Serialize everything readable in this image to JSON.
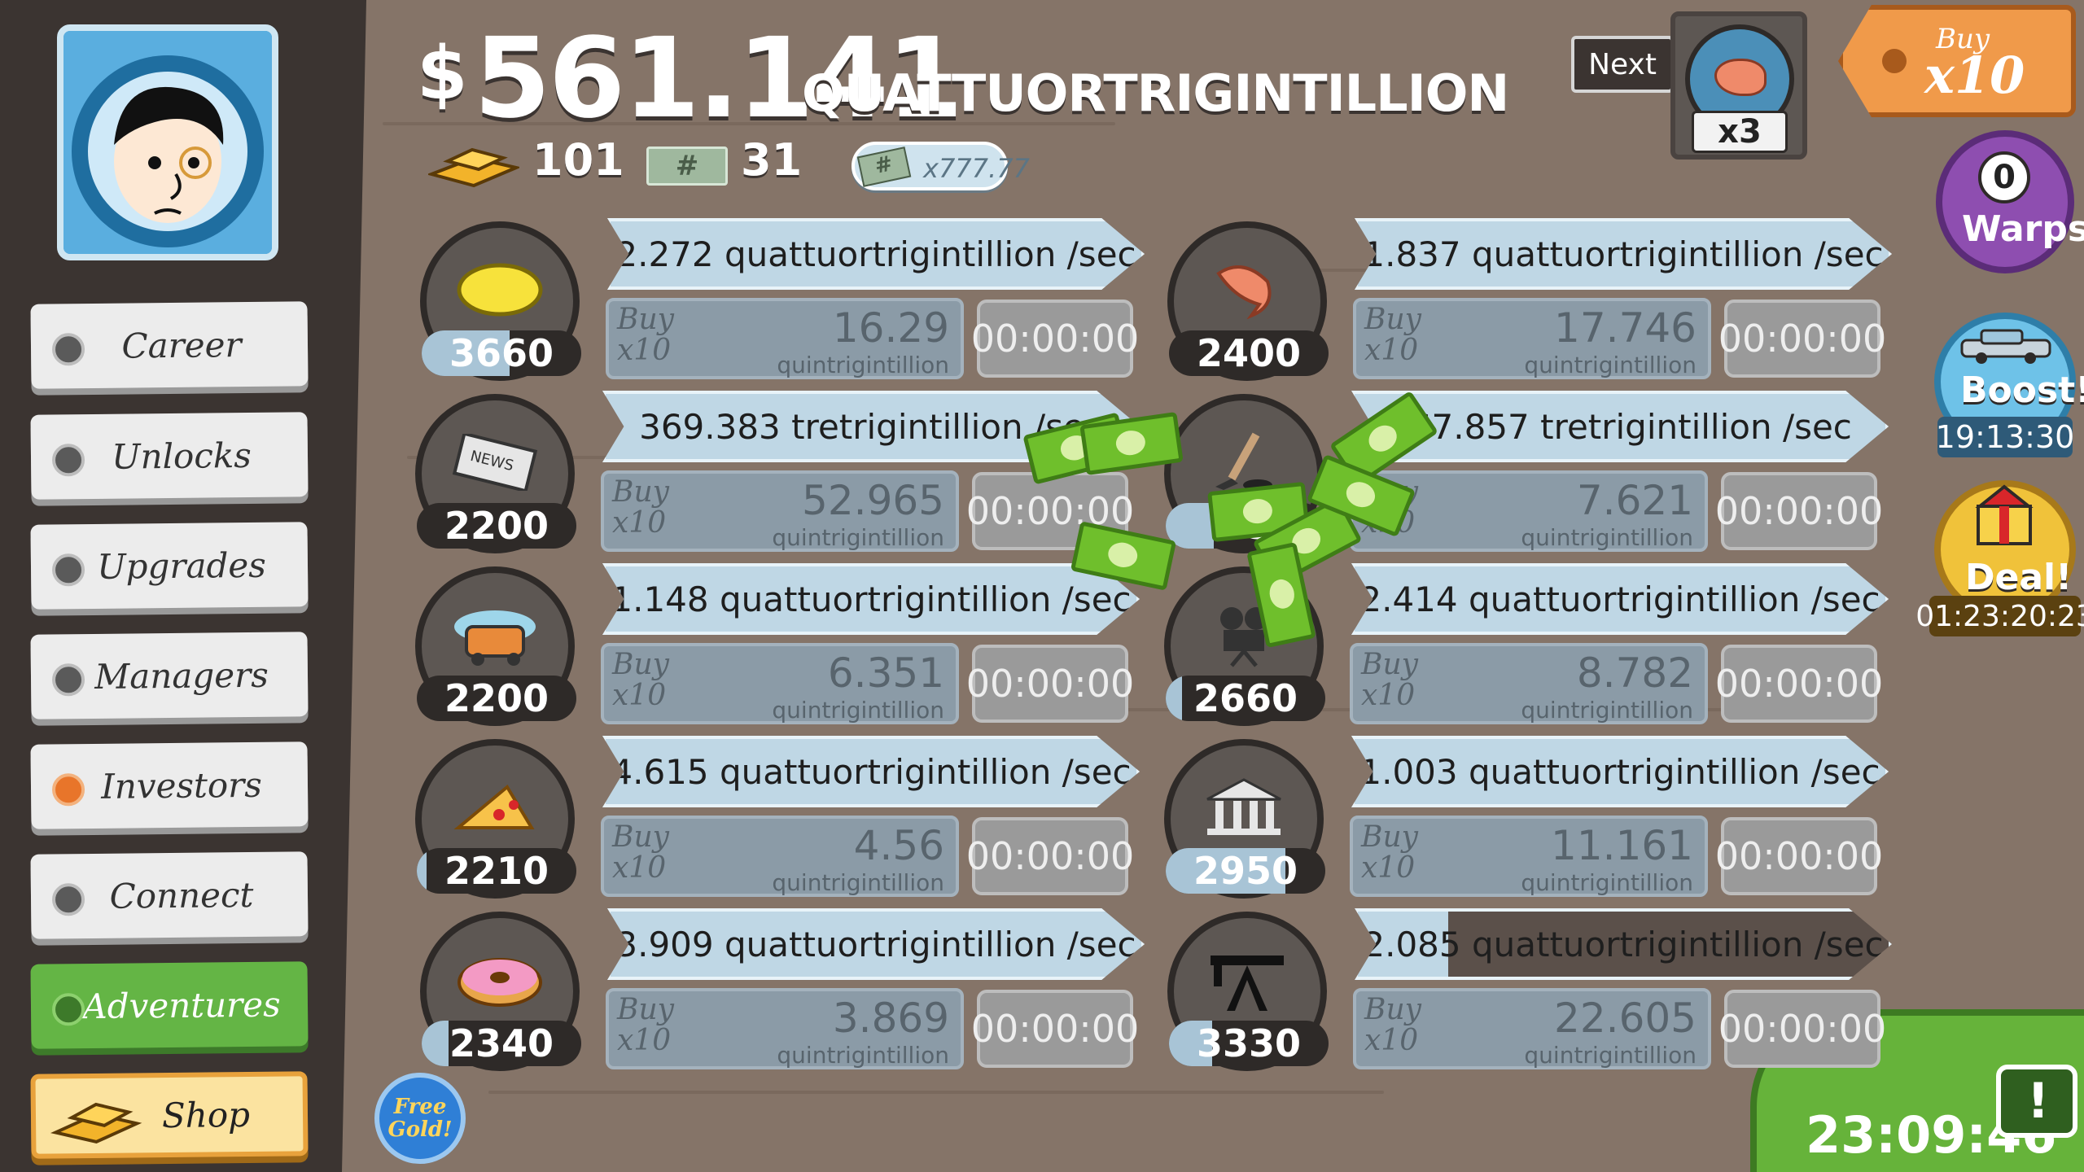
{
  "money": {
    "symbol": "$",
    "amount": "561.141",
    "unit": "QUATTUORTRIGINTILLION"
  },
  "currencies": {
    "gold": "101",
    "megabucks": "31",
    "multiplier_ticket": "x777.77"
  },
  "sidebar": {
    "items": [
      {
        "label": "Career"
      },
      {
        "label": "Unlocks"
      },
      {
        "label": "Upgrades"
      },
      {
        "label": "Managers"
      },
      {
        "label": "Investors"
      },
      {
        "label": "Connect"
      },
      {
        "label": "Adventures"
      },
      {
        "label": "Shop"
      }
    ],
    "free_gold": "Free Gold!"
  },
  "top_right": {
    "next_label": "Next",
    "next_multiplier": "x3",
    "buy_label": "Buy",
    "buy_amount": "x10",
    "warps_count": "0",
    "warps_label": "Warps",
    "boost_label": "Boost!",
    "boost_timer": "19:13:30",
    "deal_label": "Deal!",
    "deal_timer": "01:23:20:23",
    "clock": "23:09:46"
  },
  "ventures": [
    {
      "icon": "lemon-icon",
      "count": "3660",
      "count_fill": 0.55,
      "rate": "2.272 quattuortrigintillion /sec",
      "buy": "Buy",
      "mult": "x10",
      "cost": "16.29",
      "cost_unit": "quintrigintillion",
      "timer": "00:00:00"
    },
    {
      "icon": "newspaper-icon",
      "count": "2200",
      "count_fill": 0.0,
      "rate": "369.383 tretrigintillion /sec",
      "buy": "Buy",
      "mult": "x10",
      "cost": "52.965",
      "cost_unit": "quintrigintillion",
      "timer": "00:00:00"
    },
    {
      "icon": "car-wash-icon",
      "count": "2200",
      "count_fill": 0.0,
      "rate": "1.148 quattuortrigintillion /sec",
      "buy": "Buy",
      "mult": "x10",
      "cost": "6.351",
      "cost_unit": "quintrigintillion",
      "timer": "00:00:00"
    },
    {
      "icon": "pizza-icon",
      "count": "2210",
      "count_fill": 0.06,
      "rate": "4.615 quattuortrigintillion /sec",
      "buy": "Buy",
      "mult": "x10",
      "cost": "4.56",
      "cost_unit": "quintrigintillion",
      "timer": "00:00:00"
    },
    {
      "icon": "donut-icon",
      "count": "2340",
      "count_fill": 0.17,
      "rate": "3.909 quattuortrigintillion /sec",
      "buy": "Buy",
      "mult": "x10",
      "cost": "3.869",
      "cost_unit": "quintrigintillion",
      "timer": "00:00:00"
    },
    {
      "icon": "shrimp-icon",
      "count": "2400",
      "count_fill": 0.0,
      "rate": "1.837 quattuortrigintillion /sec",
      "buy": "Buy",
      "mult": "x10",
      "cost": "17.746",
      "cost_unit": "quintrigintillion",
      "timer": "00:00:00"
    },
    {
      "icon": "hockey-icon",
      "count": "25",
      "count_fill": 0.3,
      "rate": "867.857 tretrigintillion /sec",
      "buy": "Buy",
      "mult": "x10",
      "cost": "7.621",
      "cost_unit": "quintrigintillion",
      "timer": "00:00:00"
    },
    {
      "icon": "movie-camera-icon",
      "count": "2660",
      "count_fill": 0.1,
      "rate": "2.414 quattuortrigintillion /sec",
      "buy": "Buy",
      "mult": "x10",
      "cost": "8.782",
      "cost_unit": "quintrigintillion",
      "timer": "00:00:00"
    },
    {
      "icon": "bank-icon",
      "count": "2950",
      "count_fill": 0.75,
      "rate": "1.003 quattuortrigintillion /sec",
      "buy": "Buy",
      "mult": "x10",
      "cost": "11.161",
      "cost_unit": "quintrigintillion",
      "timer": "00:00:00"
    },
    {
      "icon": "oil-rig-icon",
      "count": "3330",
      "count_fill": 0.27,
      "rate": "2.085 quattuortrigintillion /sec",
      "rate_progress": 0.17,
      "buy": "Buy",
      "mult": "x10",
      "cost": "22.605",
      "cost_unit": "quintrigintillion",
      "timer": "00:00:00"
    }
  ]
}
